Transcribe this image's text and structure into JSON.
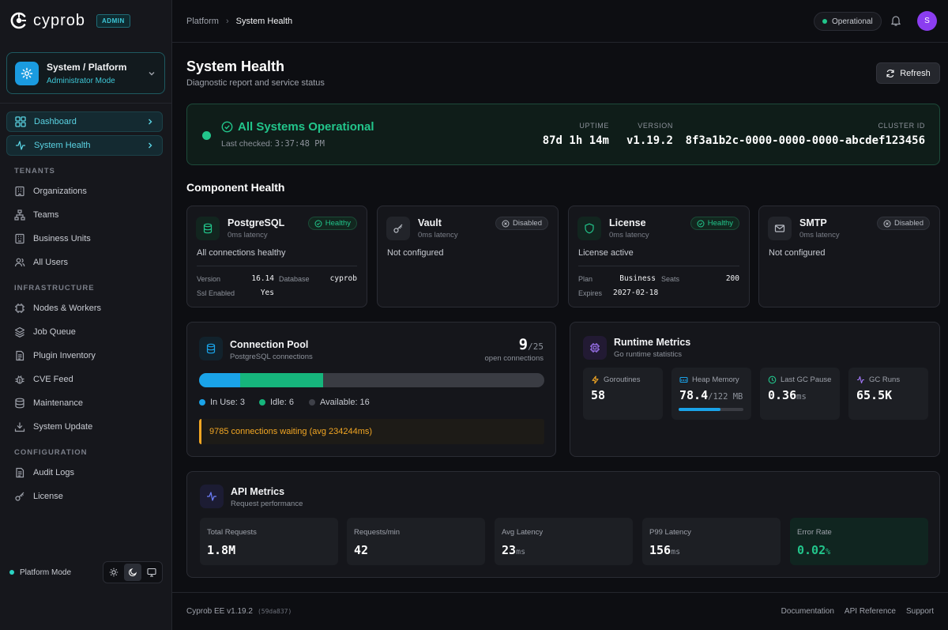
{
  "brand": {
    "name": "cyprob",
    "badge": "ADMIN"
  },
  "scope": {
    "title": "System / Platform",
    "subtitle": "Administrator Mode"
  },
  "nav": {
    "active": [
      {
        "label": "Dashboard",
        "icon": "dashboard-icon"
      },
      {
        "label": "System Health",
        "icon": "activity-icon"
      }
    ],
    "sections": [
      {
        "title": "TENANTS",
        "items": [
          "Organizations",
          "Teams",
          "Business Units",
          "All Users"
        ]
      },
      {
        "title": "INFRASTRUCTURE",
        "items": [
          "Nodes & Workers",
          "Job Queue",
          "Plugin Inventory",
          "CVE Feed",
          "Maintenance",
          "System Update"
        ]
      },
      {
        "title": "CONFIGURATION",
        "items": [
          "Audit Logs",
          "License"
        ]
      }
    ]
  },
  "sidebar_footer": {
    "mode_label": "Platform Mode",
    "theme_options": [
      "light",
      "dark",
      "system"
    ],
    "theme_selected": "dark"
  },
  "topbar": {
    "breadcrumb": [
      "Platform",
      "System Health"
    ],
    "status": "Operational",
    "avatar_initial": "S"
  },
  "page": {
    "title": "System Health",
    "subtitle": "Diagnostic report and service status",
    "refresh_label": "Refresh"
  },
  "banner": {
    "title": "All Systems Operational",
    "checked_label": "Last checked:",
    "checked_time": "3:37:48 PM",
    "uptime_label": "UPTIME",
    "uptime": "87d 1h 14m",
    "version_label": "VERSION",
    "version": "v1.19.2",
    "cluster_label": "CLUSTER ID",
    "cluster_id": "8f3a1b2c-0000-0000-0000-abcdef123456"
  },
  "component_heading": "Component Health",
  "components": [
    {
      "name": "PostgreSQL",
      "latency": "0ms latency",
      "status": "Healthy",
      "message": "All connections healthy",
      "details": [
        [
          "Version",
          "16.14"
        ],
        [
          "Database",
          "cyprob"
        ],
        [
          "Ssl Enabled",
          "Yes"
        ]
      ]
    },
    {
      "name": "Vault",
      "latency": "0ms latency",
      "status": "Disabled",
      "message": "Not configured"
    },
    {
      "name": "License",
      "latency": "0ms latency",
      "status": "Healthy",
      "message": "License active",
      "details": [
        [
          "Plan",
          "Business"
        ],
        [
          "Seats",
          "200"
        ],
        [
          "Expires",
          "2027-02-18"
        ]
      ]
    },
    {
      "name": "SMTP",
      "latency": "0ms latency",
      "status": "Disabled",
      "message": "Not configured"
    }
  ],
  "pool": {
    "title": "Connection Pool",
    "subtitle": "PostgreSQL connections",
    "open": "9",
    "max": "/25",
    "open_label": "open connections",
    "in_use": 3,
    "idle": 6,
    "available": 16,
    "total": 25,
    "legend": [
      "In Use: 3",
      "Idle: 6",
      "Available: 16"
    ],
    "colors": {
      "in_use": "#1aa3e8",
      "idle": "#16b57c",
      "available": "#3a3c43"
    },
    "warning": "9785 connections waiting (avg 234244ms)"
  },
  "runtime": {
    "title": "Runtime Metrics",
    "subtitle": "Go runtime statistics",
    "metrics": [
      {
        "label": "Goroutines",
        "value": "58",
        "unit": ""
      },
      {
        "label": "Heap Memory",
        "value": "78.4",
        "unit": "/122 MB",
        "fill": 0.643
      },
      {
        "label": "Last GC Pause",
        "value": "0.36",
        "unit": "ms"
      },
      {
        "label": "GC Runs",
        "value": "65.5K",
        "unit": ""
      }
    ]
  },
  "api": {
    "title": "API Metrics",
    "subtitle": "Request performance",
    "metrics": [
      {
        "label": "Total Requests",
        "value": "1.8M",
        "unit": ""
      },
      {
        "label": "Requests/min",
        "value": "42",
        "unit": ""
      },
      {
        "label": "Avg Latency",
        "value": "23",
        "unit": "ms"
      },
      {
        "label": "P99 Latency",
        "value": "156",
        "unit": "ms"
      },
      {
        "label": "Error Rate",
        "value": "0.02",
        "unit": "%"
      }
    ]
  },
  "footer": {
    "version": "Cyprob EE v1.19.2",
    "hash": "(59da837)",
    "links": [
      "Documentation",
      "API Reference",
      "Support"
    ]
  }
}
